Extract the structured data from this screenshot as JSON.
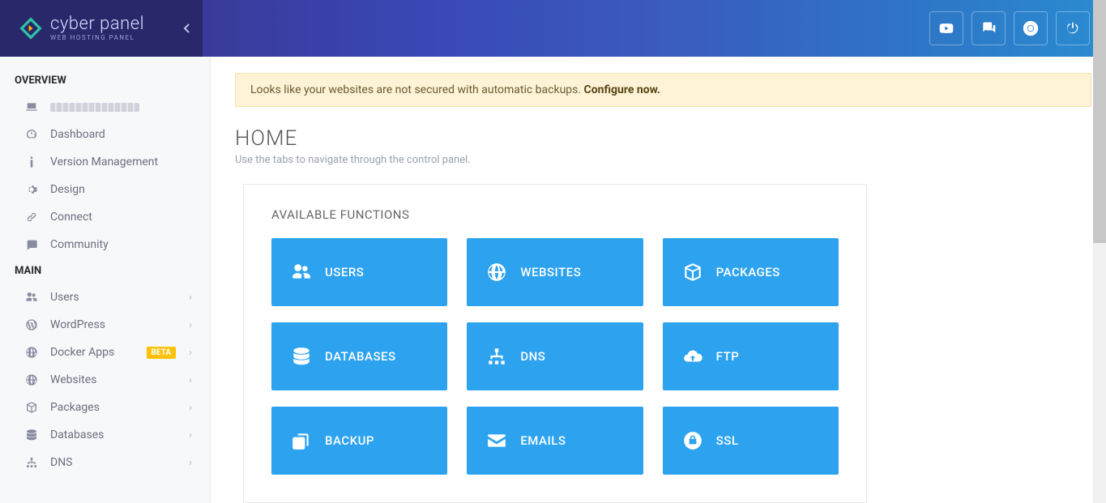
{
  "brand": {
    "title": "cyber panel",
    "subtitle": "WEB HOSTING PANEL"
  },
  "header_icons": [
    "youtube",
    "chat",
    "support",
    "power"
  ],
  "sidebar": {
    "sections": [
      {
        "title": "OVERVIEW",
        "items": [
          {
            "id": "ip",
            "label": "",
            "icon": "laptop",
            "expandable": false,
            "obscured": true
          },
          {
            "id": "dashboard",
            "label": "Dashboard",
            "icon": "dashboard",
            "expandable": false
          },
          {
            "id": "version",
            "label": "Version Management",
            "icon": "info",
            "expandable": false
          },
          {
            "id": "design",
            "label": "Design",
            "icon": "gear",
            "expandable": false
          },
          {
            "id": "connect",
            "label": "Connect",
            "icon": "link",
            "expandable": false
          },
          {
            "id": "community",
            "label": "Community",
            "icon": "comment",
            "expandable": false
          }
        ]
      },
      {
        "title": "MAIN",
        "items": [
          {
            "id": "users",
            "label": "Users",
            "icon": "users",
            "expandable": true
          },
          {
            "id": "wordpress",
            "label": "WordPress",
            "icon": "wordpress",
            "expandable": true
          },
          {
            "id": "docker",
            "label": "Docker Apps",
            "icon": "globe",
            "expandable": true,
            "badge": "BETA"
          },
          {
            "id": "websites",
            "label": "Websites",
            "icon": "globe",
            "expandable": true
          },
          {
            "id": "packages",
            "label": "Packages",
            "icon": "package",
            "expandable": true
          },
          {
            "id": "databases",
            "label": "Databases",
            "icon": "database",
            "expandable": true
          },
          {
            "id": "dns",
            "label": "DNS",
            "icon": "sitemap",
            "expandable": true
          }
        ]
      }
    ]
  },
  "alert": {
    "text": "Looks like your websites are not secured with automatic backups. ",
    "cta": "Configure now."
  },
  "page": {
    "title": "HOME",
    "subtitle": "Use the tabs to navigate through the control panel."
  },
  "card_title": "AVAILABLE FUNCTIONS",
  "tiles": [
    {
      "id": "users",
      "label": "USERS",
      "icon": "users"
    },
    {
      "id": "websites",
      "label": "WEBSITES",
      "icon": "globe"
    },
    {
      "id": "packages",
      "label": "PACKAGES",
      "icon": "package"
    },
    {
      "id": "databases",
      "label": "DATABASES",
      "icon": "database"
    },
    {
      "id": "dns",
      "label": "DNS",
      "icon": "sitemap"
    },
    {
      "id": "ftp",
      "label": "FTP",
      "icon": "cloud"
    },
    {
      "id": "backup",
      "label": "BACKUP",
      "icon": "copy"
    },
    {
      "id": "emails",
      "label": "EMAILS",
      "icon": "envelope"
    },
    {
      "id": "ssl",
      "label": "SSL",
      "icon": "lock"
    }
  ]
}
